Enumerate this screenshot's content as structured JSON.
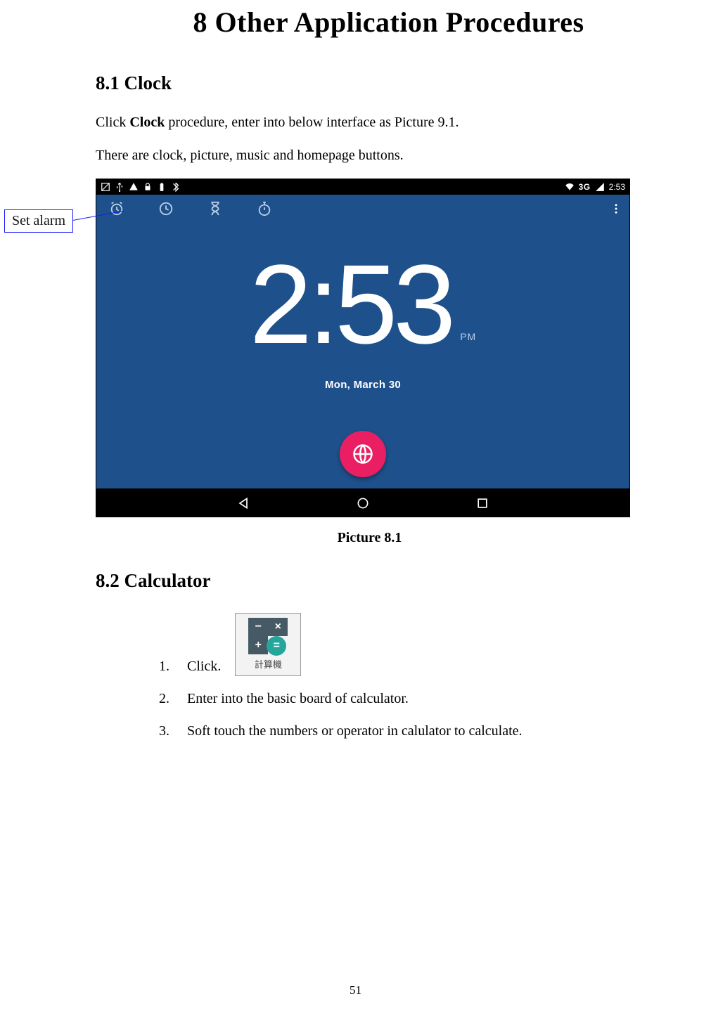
{
  "chapter": {
    "title": "8 Other Application Procedures"
  },
  "section81": {
    "heading": "8.1 Clock",
    "p1_a": "Click ",
    "p1_b": "Clock",
    "p1_c": " procedure, enter into below interface as Picture 9.1.",
    "p2": "There are clock, picture, music and homepage buttons."
  },
  "callout": {
    "label": "Set alarm"
  },
  "screenshot": {
    "status": {
      "time": "2:53",
      "net": "3G"
    },
    "clock": {
      "time": "2:53",
      "ampm": "PM",
      "date": "Mon, March 30"
    }
  },
  "caption81": "Picture 8.1",
  "section82": {
    "heading": "8.2 Calculator",
    "step1": "Click.",
    "step2": "Enter into the basic board of calculator.",
    "step3": "Soft touch the numbers or operator in calulator to calculate.",
    "icon_label": "計算機"
  },
  "page_number": "51"
}
